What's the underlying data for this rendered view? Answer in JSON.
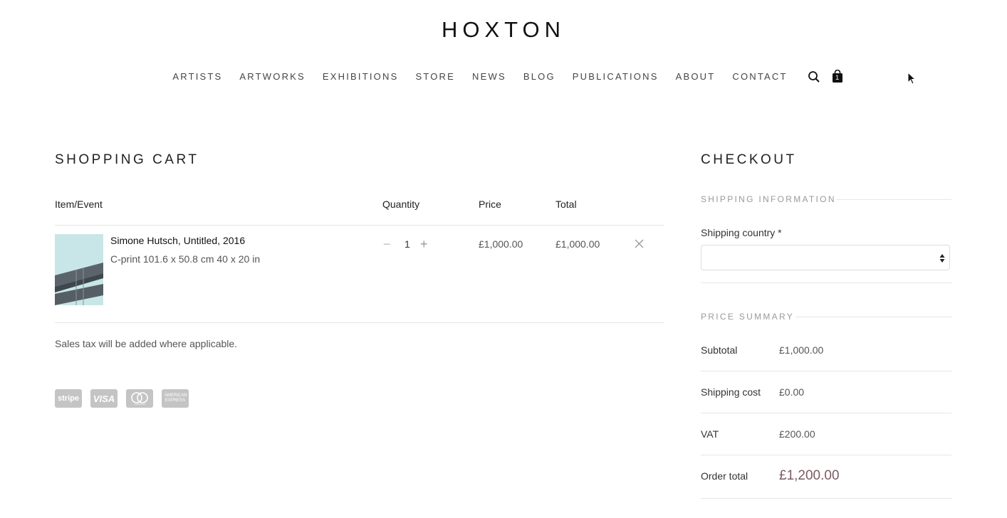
{
  "brand": "HOXTON",
  "nav": {
    "items": [
      "ARTISTS",
      "ARTWORKS",
      "EXHIBITIONS",
      "STORE",
      "NEWS",
      "BLOG",
      "PUBLICATIONS",
      "ABOUT",
      "CONTACT"
    ],
    "search_icon": "search-icon",
    "cart_icon": "shopping-bag-icon",
    "cart_count": "1"
  },
  "cart": {
    "title": "SHOPPING CART",
    "headers": {
      "item": "Item/Event",
      "quantity": "Quantity",
      "price": "Price",
      "total": "Total"
    },
    "items": [
      {
        "title": "Simone Hutsch, Untitled, 2016",
        "description": "C-print 101.6 x 50.8 cm 40 x 20 in",
        "quantity": "1",
        "price": "£1,000.00",
        "total": "£1,000.00"
      }
    ],
    "tax_note": "Sales tax will be added where applicable.",
    "payment_methods": [
      "stripe",
      "VISA",
      "mastercard",
      "AMERICAN EXPRESS"
    ]
  },
  "checkout": {
    "title": "CHECKOUT",
    "shipping_section": "SHIPPING INFORMATION",
    "shipping_country_label": "Shipping country *",
    "shipping_country_value": "",
    "price_summary_section": "PRICE SUMMARY",
    "summary": {
      "subtotal_label": "Subtotal",
      "subtotal_value": "£1,000.00",
      "shipping_label": "Shipping cost",
      "shipping_value": "£0.00",
      "vat_label": "VAT",
      "vat_value": "£200.00",
      "order_total_label": "Order total",
      "order_total_value": "£1,200.00"
    }
  },
  "colors": {
    "accent_total": "#7b5c62",
    "muted": "#999999",
    "divider": "#e6e6e6"
  }
}
